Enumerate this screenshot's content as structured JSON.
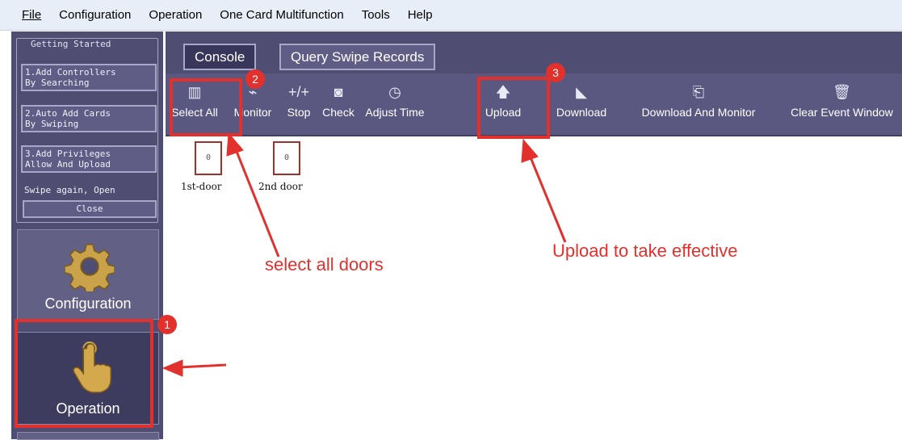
{
  "menu": [
    "File",
    "Configuration",
    "Operation",
    "One Card Multifunction",
    "Tools",
    "Help"
  ],
  "getting_started": {
    "title": "Getting Started",
    "step1": "1.Add Controllers\nBy Searching",
    "step2": "2.Auto Add Cards\nBy Swiping",
    "step3": "3.Add Privileges\nAllow And Upload",
    "swipe_text": "Swipe again, Open",
    "close": "Close"
  },
  "nav": {
    "configuration": "Configuration",
    "operation": "Operation"
  },
  "tabs": {
    "console": "Console",
    "query": "Query Swipe Records"
  },
  "toolbar": {
    "select_all": "Select All",
    "monitor": "Monitor",
    "stop": "Stop",
    "check": "Check",
    "adjust_time": "Adjust Time",
    "upload": "Upload",
    "download": "Download",
    "download_monitor": "Download And Monitor",
    "clear_event": "Clear Event Window"
  },
  "doors": [
    {
      "label": "1st-door",
      "value": "0"
    },
    {
      "label": "2nd door",
      "value": "0"
    }
  ],
  "annotations": {
    "badge1": "1",
    "badge2": "2",
    "badge3": "3",
    "select_all_doors": "select all doors",
    "upload_effective": "Upload to take effective"
  },
  "icons": [
    "gear-icon",
    "hand-icon",
    "select-all-icon",
    "monitor-icon",
    "stop-icon",
    "check-icon",
    "clock-icon",
    "upload-arrow-icon",
    "download-icon",
    "download-monitor-icon",
    "trash-icon"
  ],
  "colors": {
    "highlight": "#e2312d",
    "panel": "#4f4d72",
    "toolbar": "#5a5880"
  }
}
